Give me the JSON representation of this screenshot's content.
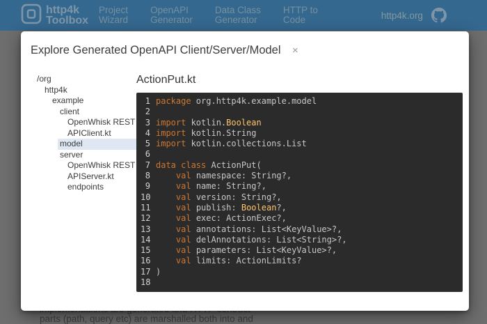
{
  "colors": {
    "nav_bg": "#35688F",
    "nav_text": "#7E96A8",
    "code_bg": "#2B2B2B",
    "code_keyword": "#CC7832",
    "code_type": "#FFC66D",
    "code_text": "#C8C8C8",
    "tree_selection_bg": "#DEE7F2"
  },
  "nav": {
    "brand": {
      "line1": "http4k",
      "line2": "Toolbox"
    },
    "items": [
      {
        "lines": [
          "Project",
          "Wizard"
        ]
      },
      {
        "lines": [
          "OpenAPI",
          "Generator"
        ]
      },
      {
        "lines": [
          "Data Class",
          "Generator"
        ]
      },
      {
        "lines": [
          "HTTP to",
          "Code"
        ]
      }
    ],
    "link": "http4k.org",
    "github_icon": "github-octocat"
  },
  "background_text": {
    "line1": "implementations are generated and HTTP contract",
    "line2": "parts (path, query etc) are marshalled both into and"
  },
  "modal": {
    "title": "Explore Generated OpenAPI Client/Server/Model",
    "close_label": "×",
    "tree": {
      "items": [
        {
          "lines": [
            "/org"
          ],
          "depth": 0
        },
        {
          "lines": [
            "http4k"
          ],
          "depth": 1
        },
        {
          "lines": [
            "example"
          ],
          "depth": 2
        },
        {
          "lines": [
            "client"
          ],
          "depth": 3
        },
        {
          "lines": [
            "OpenWhisk REST",
            "APIClient.kt"
          ],
          "depth": 4
        },
        {
          "lines": [
            "model"
          ],
          "depth": 3,
          "selected": true
        },
        {
          "lines": [
            "server"
          ],
          "depth": 3
        },
        {
          "lines": [
            "OpenWhisk REST",
            "APIServer.kt"
          ],
          "depth": 4
        },
        {
          "lines": [
            "endpoints"
          ],
          "depth": 4
        }
      ]
    },
    "file": {
      "name": "ActionPut.kt"
    },
    "code": {
      "lines": [
        {
          "n": 1,
          "tokens": [
            {
              "c": "kw",
              "t": "package"
            },
            {
              "c": "pl",
              "t": " org.http4k.example.model"
            }
          ]
        },
        {
          "n": 2,
          "tokens": []
        },
        {
          "n": 3,
          "tokens": [
            {
              "c": "kw",
              "t": "import"
            },
            {
              "c": "pl",
              "t": " kotlin."
            },
            {
              "c": "ty",
              "t": "Boolean"
            }
          ]
        },
        {
          "n": 4,
          "tokens": [
            {
              "c": "kw",
              "t": "import"
            },
            {
              "c": "pl",
              "t": " kotlin.String"
            }
          ]
        },
        {
          "n": 5,
          "tokens": [
            {
              "c": "kw",
              "t": "import"
            },
            {
              "c": "pl",
              "t": " kotlin.collections.List"
            }
          ]
        },
        {
          "n": 6,
          "tokens": []
        },
        {
          "n": 7,
          "tokens": [
            {
              "c": "kw",
              "t": "data class"
            },
            {
              "c": "pl",
              "t": " ActionPut("
            }
          ]
        },
        {
          "n": 8,
          "tokens": [
            {
              "c": "pl",
              "t": "    "
            },
            {
              "c": "kw",
              "t": "val"
            },
            {
              "c": "pl",
              "t": " namespace: String?,"
            }
          ]
        },
        {
          "n": 9,
          "tokens": [
            {
              "c": "pl",
              "t": "    "
            },
            {
              "c": "kw",
              "t": "val"
            },
            {
              "c": "pl",
              "t": " name: String?,"
            }
          ]
        },
        {
          "n": 10,
          "tokens": [
            {
              "c": "pl",
              "t": "    "
            },
            {
              "c": "kw",
              "t": "val"
            },
            {
              "c": "pl",
              "t": " version: String?,"
            }
          ]
        },
        {
          "n": 11,
          "tokens": [
            {
              "c": "pl",
              "t": "    "
            },
            {
              "c": "kw",
              "t": "val"
            },
            {
              "c": "pl",
              "t": " publish: "
            },
            {
              "c": "ty",
              "t": "Boolean"
            },
            {
              "c": "pl",
              "t": "?,"
            }
          ]
        },
        {
          "n": 12,
          "tokens": [
            {
              "c": "pl",
              "t": "    "
            },
            {
              "c": "kw",
              "t": "val"
            },
            {
              "c": "pl",
              "t": " exec: ActionExec?,"
            }
          ]
        },
        {
          "n": 13,
          "tokens": [
            {
              "c": "pl",
              "t": "    "
            },
            {
              "c": "kw",
              "t": "val"
            },
            {
              "c": "pl",
              "t": " annotations: List<KeyValue>?,"
            }
          ]
        },
        {
          "n": 14,
          "tokens": [
            {
              "c": "pl",
              "t": "    "
            },
            {
              "c": "kw",
              "t": "val"
            },
            {
              "c": "pl",
              "t": " delAnnotations: List<String>?,"
            }
          ]
        },
        {
          "n": 15,
          "tokens": [
            {
              "c": "pl",
              "t": "    "
            },
            {
              "c": "kw",
              "t": "val"
            },
            {
              "c": "pl",
              "t": " parameters: List<KeyValue>?,"
            }
          ]
        },
        {
          "n": 16,
          "tokens": [
            {
              "c": "pl",
              "t": "    "
            },
            {
              "c": "kw",
              "t": "val"
            },
            {
              "c": "pl",
              "t": " limits: ActionLimits?"
            }
          ]
        },
        {
          "n": 17,
          "tokens": [
            {
              "c": "pl",
              "t": ")"
            }
          ]
        },
        {
          "n": 18,
          "tokens": []
        }
      ]
    }
  }
}
